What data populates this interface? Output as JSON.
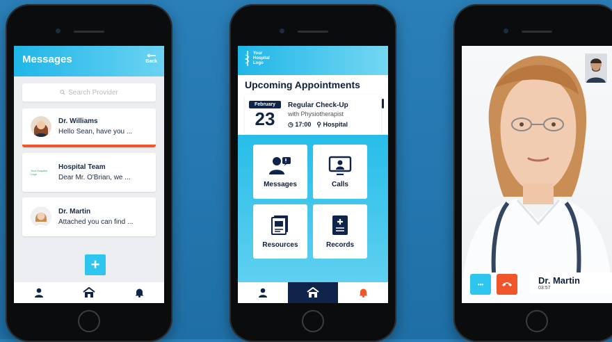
{
  "messages_screen": {
    "title": "Messages",
    "back_label": "Back",
    "search_placeholder": "Search Provider",
    "conversations": [
      {
        "name": "Dr. Williams",
        "preview": "Hello Sean, have you ..."
      },
      {
        "name": "Hospital Team",
        "preview": "Dear Mr. O'Brian, we ..."
      },
      {
        "name": "Dr. Martin",
        "preview": "Attached you can find ..."
      }
    ],
    "hospital_logo_text": "Your Hospital Logo",
    "add_label": "+"
  },
  "home_screen": {
    "logo_line1": "Your",
    "logo_line2": "Hospital",
    "logo_line3": "Logo",
    "section_title": "Upcoming Appointments",
    "appointment": {
      "month": "February",
      "day": "23",
      "title": "Regular Check-Up",
      "subtitle": "with Physiotherapist",
      "time": "17:00",
      "location": "Hospital"
    },
    "tiles": [
      "Messages",
      "Calls",
      "Resources",
      "Records"
    ]
  },
  "call_screen": {
    "caller_name": "Dr. Martin",
    "duration": "03:57",
    "more_label": "•••"
  },
  "colors": {
    "accent": "#1fb6e8",
    "navy": "#0f2448",
    "alert": "#f0562a"
  },
  "nav_icons": [
    "user-icon",
    "home-icon",
    "bell-icon"
  ]
}
